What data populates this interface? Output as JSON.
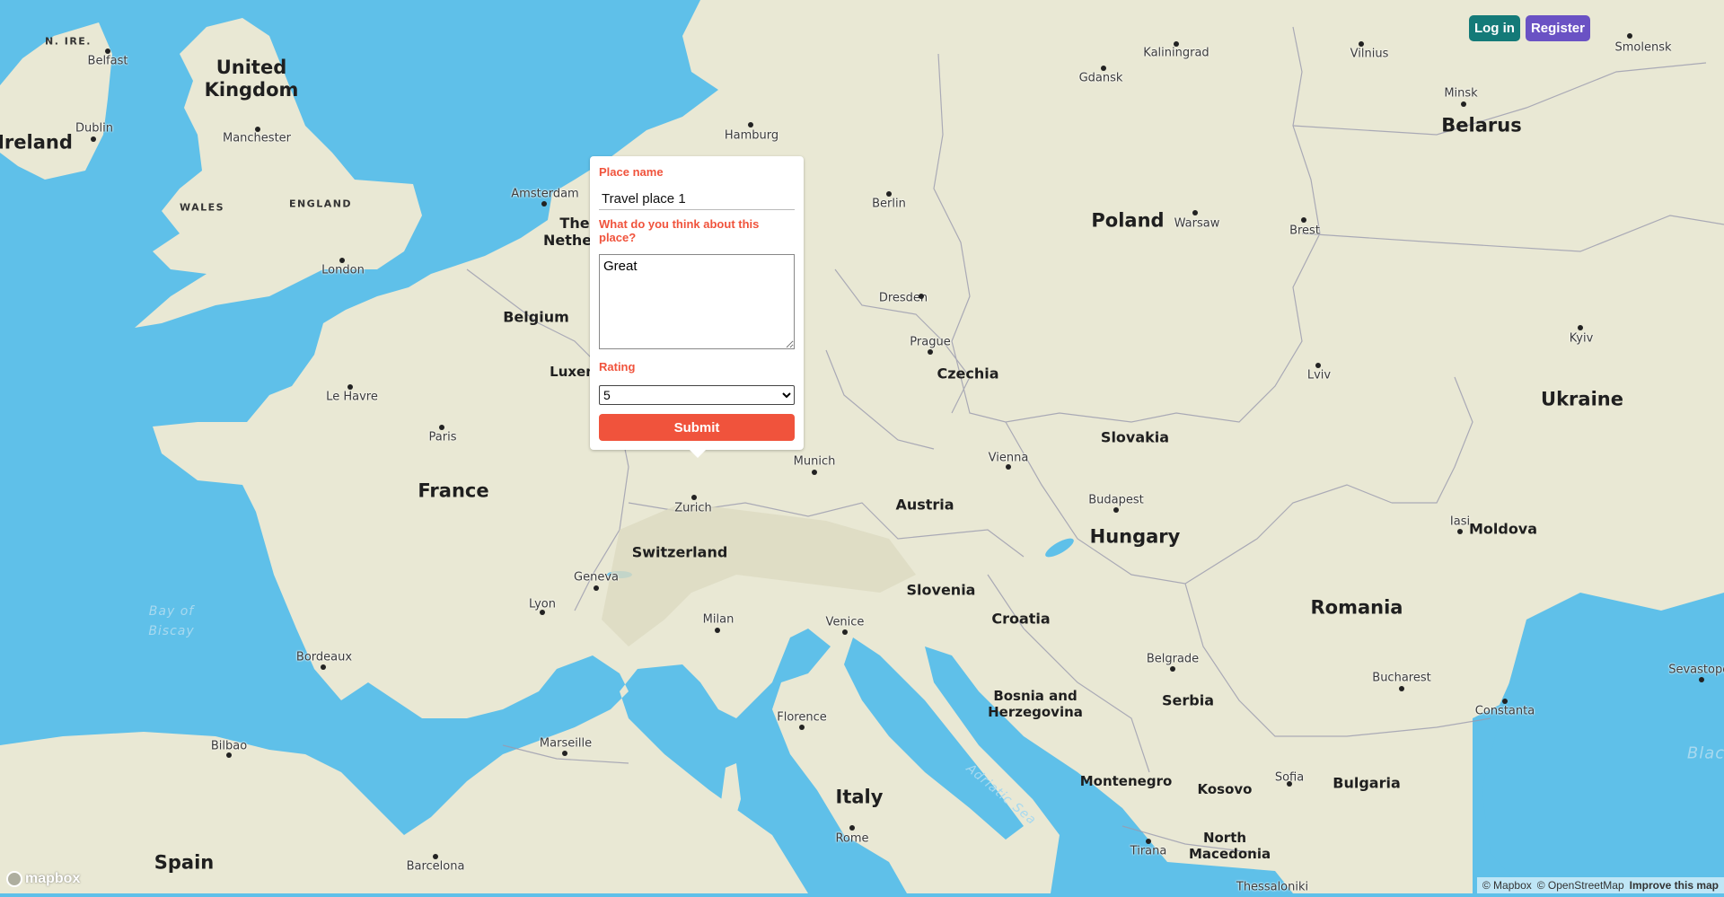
{
  "auth": {
    "login_label": "Log in",
    "register_label": "Register"
  },
  "popup": {
    "place_name_label": "Place name",
    "place_name_value": "Travel place 1",
    "review_label": "What do you think about this place?",
    "review_value": "Great",
    "rating_label": "Rating",
    "rating_value": "5",
    "submit_label": "Submit"
  },
  "map": {
    "countries": [
      "United Kingdom",
      "Ireland",
      "France",
      "Belgium",
      "The Netherlands",
      "Poland",
      "Belarus",
      "Ukraine",
      "Czechia",
      "Slovakia",
      "Austria",
      "Hungary",
      "Switzerland",
      "Slovenia",
      "Croatia",
      "Romania",
      "Moldova",
      "Bosnia and Herzegovina",
      "Serbia",
      "Montenegro",
      "Kosovo",
      "North Macedonia",
      "Bulgaria",
      "Italy",
      "Spain"
    ],
    "regions": [
      "N. IRE.",
      "WALES",
      "ENGLAND"
    ],
    "cities": [
      "Belfast",
      "Dublin",
      "Manchester",
      "London",
      "Amsterdam",
      "Hamburg",
      "Berlin",
      "Gdansk",
      "Kaliningrad",
      "Vilnius",
      "Minsk",
      "Smolensk",
      "Warsaw",
      "Brest",
      "Kyiv",
      "Lviv",
      "Dresden",
      "Prague",
      "Vienna",
      "Munich",
      "Zurich",
      "Geneva",
      "Lyon",
      "Paris",
      "Le Havre",
      "Bordeaux",
      "Milan",
      "Venice",
      "Budapest",
      "Iasi",
      "Belgrade",
      "Bucharest",
      "Constanta",
      "Sevastopol",
      "Sofia",
      "Tirana",
      "Florence",
      "Rome",
      "Marseille",
      "Bilbao",
      "Barcelona",
      "Thessaloniki",
      "Luxem"
    ],
    "seas": [
      "Bay of Biscay",
      "Adriatic Sea",
      "Blac"
    ]
  },
  "branding": {
    "logo_text": "mapbox"
  },
  "attribution": {
    "mapbox": "© Mapbox",
    "osm": "© OpenStreetMap",
    "improve": "Improve this map"
  },
  "colors": {
    "water": "#5fc0e9",
    "land": "#e9e8d4",
    "accent": "#f0533c",
    "login": "#147a78",
    "register": "#6a52c4"
  }
}
